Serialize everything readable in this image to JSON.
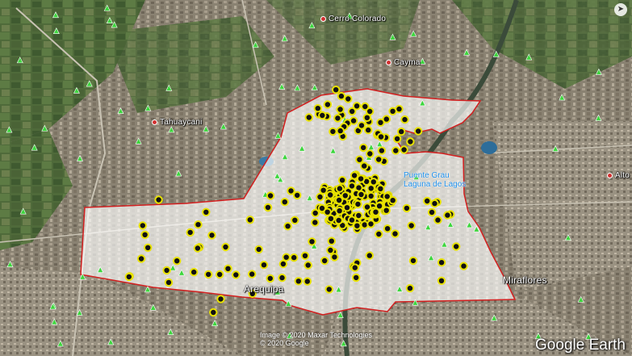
{
  "places": {
    "cerro_colorado": "Cerro Colorado",
    "cayma": "Cayma",
    "tahuaycani": "Tahuaycani",
    "arequipa": "Arequipa",
    "miraflores": "Miraflores",
    "alto": "Alto"
  },
  "poi": {
    "line1": "Puente Grau",
    "line2": "Laguna de Lagos"
  },
  "attribution": {
    "image_credit": "Image © 2020 Maxar Technologies",
    "copyright": "© 2020 Google"
  },
  "watermark": "Google Earth",
  "colors": {
    "boundary_stroke": "#d21f1f",
    "boundary_fill": "#ffffff",
    "marker_ring": "#e8e200",
    "tree_marker": "#3ed63e"
  },
  "icons": {
    "point_marker": "yellow-ring-marker-icon",
    "tree_marker": "green-tree-icon",
    "place_dot": "red-dot-icon",
    "compass": "compass-icon"
  }
}
